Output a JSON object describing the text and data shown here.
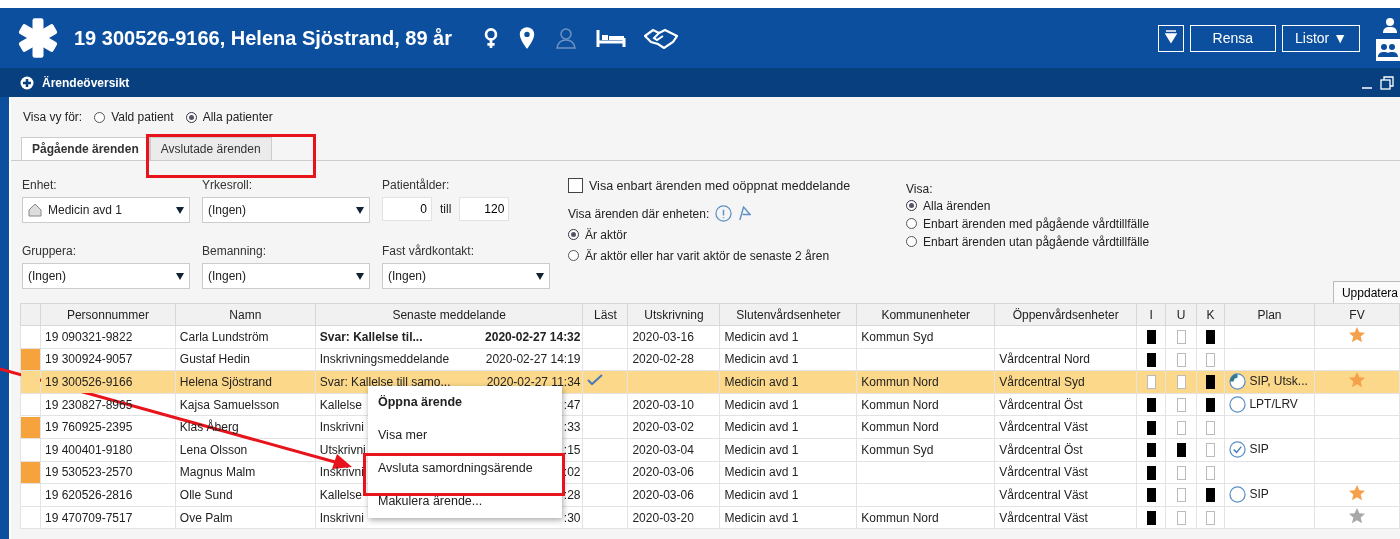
{
  "header": {
    "patient": "19 300526-9166,  Helena Sjöstrand,  89 år",
    "buttons": [
      {
        "label": "Rensa",
        "kind": "plain"
      },
      {
        "label": "Listor ▼",
        "kind": "menu"
      }
    ]
  },
  "panel": {
    "title": "Ärendeöversikt"
  },
  "view_for": {
    "label": "Visa vy för:",
    "options": [
      {
        "label": "Vald patient",
        "selected": false
      },
      {
        "label": "Alla patienter",
        "selected": true
      }
    ]
  },
  "tabs": [
    {
      "label": "Pågående ärenden",
      "selected": true
    },
    {
      "label": "Avslutade ärenden",
      "selected": false
    }
  ],
  "filters": [
    {
      "label": "Enhet:",
      "value": "Medicin avd 1",
      "kind": "unit"
    },
    {
      "label": "Yrkesroll:",
      "value": "(Ingen)",
      "kind": "plain"
    },
    {
      "label": "Gruppera:",
      "value": "(Ingen)",
      "kind": "plain"
    },
    {
      "label": "Bemanning:",
      "value": "(Ingen)",
      "kind": "plain"
    },
    {
      "label": "Fast vårdkontakt:",
      "value": "(Ingen)",
      "kind": "plain"
    }
  ],
  "age": {
    "label": "Patientålder:",
    "from": "0",
    "separator": "till",
    "to": "120"
  },
  "unread_only": {
    "label": "Visa enbart ärenden med oöppnat meddelande",
    "checked": false
  },
  "actor": {
    "label": "Visa ärenden där enheten:",
    "options": [
      {
        "label": "Är aktör",
        "selected": true
      },
      {
        "label": "Är aktör eller har varit aktör de senaste 2 åren",
        "selected": false
      }
    ]
  },
  "show": {
    "label": "Visa:",
    "options": [
      {
        "label": "Alla ärenden",
        "selected": true
      },
      {
        "label": "Enbart ärenden med pågående vårdtillfälle",
        "selected": false
      },
      {
        "label": "Enbart ärenden utan pågående vårdtillfälle",
        "selected": false
      }
    ]
  },
  "refresh_button": "Uppdatera",
  "table": {
    "columns": [
      "Personnummer",
      "Namn",
      "Senaste meddelande",
      "Läst",
      "Utskrivning",
      "Slutenvårdsenheter",
      "Kommunenheter",
      "Öppenvårdsenheter",
      "I",
      "U",
      "K",
      "Plan",
      "FV"
    ],
    "rows": [
      {
        "flagged": false,
        "selected": false,
        "bold": true,
        "pnr": "19 090321-9822",
        "name": "Carla Lundström",
        "message": "Svar: Kallelse til...",
        "time": "2020-02-27 14:32",
        "read": false,
        "discharge": "2020-03-16",
        "inpatient": "Medicin avd 1",
        "municipal": "Kommun Syd",
        "i": true,
        "u": false,
        "k": true,
        "fv": {
          "color": "#f5a04a"
        }
      },
      {
        "flagged": true,
        "selected": false,
        "bold": false,
        "pnr": "19 300924-9057",
        "name": "Gustaf Hedin",
        "message": "Inskrivningsmeddelande",
        "time": "2020-02-27 14:19",
        "read": false,
        "discharge": "2020-02-28",
        "inpatient": "Medicin avd 1",
        "outpatient": "Vårdcentral Nord",
        "i": true,
        "u": false,
        "k": false
      },
      {
        "flagged": false,
        "selected": true,
        "bold": false,
        "pnr": "19 300526-9166",
        "name": "Helena Sjöstrand",
        "message": "Svar: Kallelse till samo...",
        "time": "2020-02-27 11:34",
        "read": true,
        "inpatient": "Medicin avd 1",
        "municipal": "Kommun Nord",
        "outpatient": "Vårdcentral Syd",
        "i": false,
        "u": false,
        "k": true,
        "plan": {
          "kind": "partial",
          "text": "SIP, Utsk..."
        },
        "fv": {
          "color": "#f5a04a"
        }
      },
      {
        "flagged": false,
        "selected": false,
        "bold": false,
        "pnr": "19 230827-8965",
        "name": "Kajsa Samuelsson",
        "message": "Kallelse",
        "time": ":47",
        "read": false,
        "discharge": "2020-03-10",
        "inpatient": "Medicin avd 1",
        "municipal": "Kommun Nord",
        "outpatient": "Vårdcentral Öst",
        "i": true,
        "u": false,
        "k": true,
        "plan": {
          "kind": "open",
          "text": "LPT/LRV"
        }
      },
      {
        "flagged": true,
        "selected": false,
        "bold": false,
        "pnr": "19 760925-2395",
        "name": "Klas Åberg",
        "message": "Inskrivni",
        "time": ":33",
        "read": false,
        "discharge": "2020-03-02",
        "inpatient": "Medicin avd 1",
        "municipal": "Kommun Nord",
        "outpatient": "Vårdcentral Väst",
        "i": true,
        "u": false,
        "k": false
      },
      {
        "flagged": false,
        "selected": false,
        "bold": false,
        "pnr": "19 400401-9180",
        "name": "Lena Olsson",
        "message": "Utskrivni",
        "time": ":15",
        "read": false,
        "discharge": "2020-03-04",
        "inpatient": "Medicin avd 1",
        "municipal": "Kommun Syd",
        "outpatient": "Vårdcentral Öst",
        "i": true,
        "u": true,
        "k": false,
        "plan": {
          "kind": "done",
          "text": "SIP"
        }
      },
      {
        "flagged": true,
        "selected": false,
        "bold": false,
        "pnr": "19 530523-2570",
        "name": "Magnus Malm",
        "message": "Inskrivni",
        "time": ":02",
        "read": false,
        "discharge": "2020-03-06",
        "inpatient": "Medicin avd 1",
        "outpatient": "Vårdcentral Väst",
        "i": true,
        "u": false,
        "k": false
      },
      {
        "flagged": false,
        "selected": false,
        "bold": false,
        "pnr": "19 620526-2816",
        "name": "Olle Sund",
        "message": "Kallelse",
        "time": ":28",
        "read": false,
        "discharge": "2020-03-06",
        "inpatient": "Medicin avd 1",
        "outpatient": "Vårdcentral Väst",
        "i": true,
        "u": false,
        "k": true,
        "plan": {
          "kind": "open",
          "text": "SIP"
        },
        "fv": {
          "color": "#f5a04a"
        }
      },
      {
        "flagged": false,
        "selected": false,
        "bold": false,
        "pnr": "19 470709-7517",
        "name": "Ove Palm",
        "message": "Inskrivni",
        "time": ":30",
        "read": false,
        "discharge": "2020-03-20",
        "inpatient": "Medicin avd 1",
        "municipal": "Kommun Nord",
        "outpatient": "Vårdcentral Väst",
        "i": true,
        "u": false,
        "k": false,
        "fv": {
          "color": "#a8a8a8"
        }
      }
    ]
  },
  "context_menu": [
    {
      "label": "Öppna ärende",
      "kind": "default"
    },
    {
      "label": "Visa mer",
      "kind": "plain"
    },
    {
      "label": "Avsluta samordningsärende",
      "kind": "plain"
    },
    {
      "label": "Makulera ärende...",
      "kind": "plain"
    }
  ]
}
